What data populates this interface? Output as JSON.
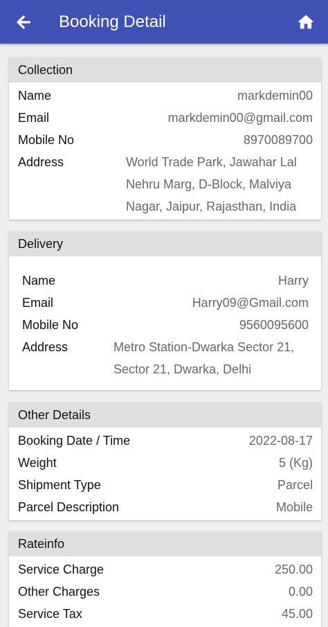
{
  "appbar": {
    "title": "Booking Detail",
    "back_icon": "arrow-back-icon",
    "home_icon": "home-icon",
    "color": "#3f51b5"
  },
  "collection": {
    "header": "Collection",
    "name_label": "Name",
    "name": "markdemin00",
    "email_label": "Email",
    "email": "markdemin00@gmail.com",
    "mobile_label": "Mobile No",
    "mobile": "8970089700",
    "address_label": "Address",
    "address": "World Trade Park, Jawahar Lal Nehru Marg, D-Block, Malviya Nagar, Jaipur, Rajasthan, India"
  },
  "delivery": {
    "header": "Delivery",
    "name_label": "Name",
    "name": "Harry",
    "email_label": "Email",
    "email": "Harry09@Gmail.com",
    "mobile_label": "Mobile No",
    "mobile": "9560095600",
    "address_label": "Address",
    "address": "Metro Station-Dwarka Sector 21, Sector 21, Dwarka, Delhi"
  },
  "other": {
    "header": "Other Details",
    "date_label": "Booking Date / Time",
    "date": "2022-08-17",
    "weight_label": "Weight",
    "weight": "5 (Kg)",
    "shipment_label": "Shipment Type",
    "shipment": "Parcel",
    "desc_label": "Parcel Description",
    "desc": "Mobile"
  },
  "rate": {
    "header": "Rateinfo",
    "service_label": "Service Charge",
    "service": "250.00",
    "other_label": "Other Charges",
    "other": "0.00",
    "tax_label": "Service Tax",
    "tax": "45.00"
  }
}
